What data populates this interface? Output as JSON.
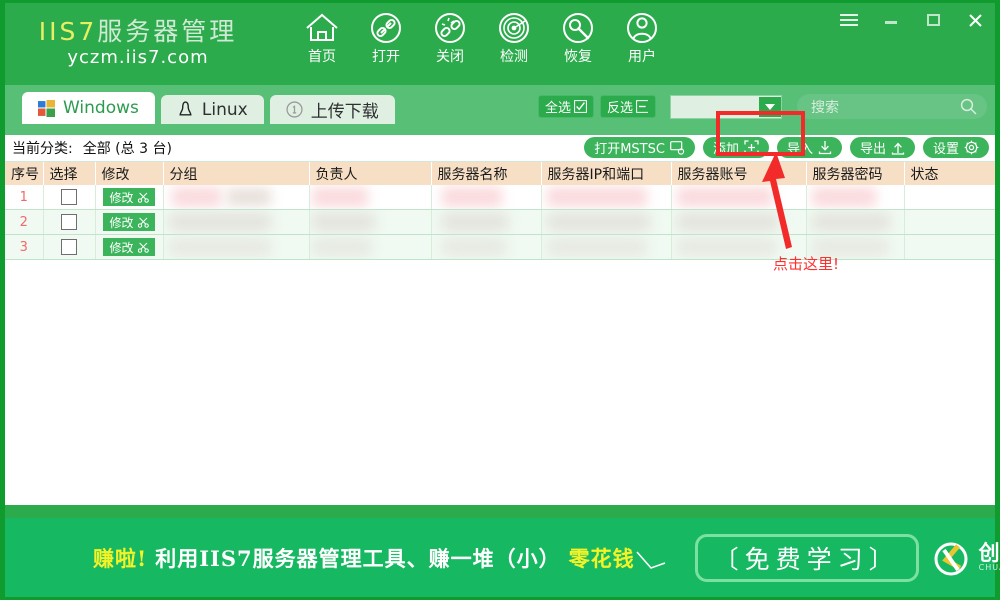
{
  "window": {
    "brand_title_prefix": "IIS7",
    "brand_title_rest": "服务器管理",
    "brand_sub": "yczm.iis7.com",
    "controls": {
      "menu": "menu-icon",
      "minimize": "minimize-icon",
      "maximize": "maximize-icon",
      "close": "close-icon"
    },
    "accent_green": "#2cab4c",
    "panel_green": "#58bf77",
    "header_orange": "#f6dfc4",
    "annotation_red": "#f22a2a"
  },
  "nav": {
    "items": [
      {
        "label": "首页",
        "icon": "home-icon"
      },
      {
        "label": "打开",
        "icon": "link-open-icon"
      },
      {
        "label": "关闭",
        "icon": "link-break-icon"
      },
      {
        "label": "检测",
        "icon": "radar-detect-icon"
      },
      {
        "label": "恢复",
        "icon": "wrench-restore-icon"
      },
      {
        "label": "用户",
        "icon": "user-icon"
      }
    ]
  },
  "tabs": [
    {
      "label": "Windows",
      "icon": "windows-logo-icon",
      "active": true
    },
    {
      "label": "Linux",
      "icon": "tux-penguin-icon",
      "active": false
    },
    {
      "label": "上传下载",
      "icon": "circle-one-icon",
      "active": false
    }
  ],
  "toolbar": {
    "select_all_label": "全选",
    "invert_select_label": "反选",
    "group_select_value": "",
    "search_placeholder": "搜索"
  },
  "subbar": {
    "category_label": "当前分类:",
    "category_value": "全部 (总 3 台)",
    "actions": [
      {
        "label": "打开MSTSC",
        "icon": "monitor-icon"
      },
      {
        "label": "添加",
        "icon": "plus-square-icon"
      },
      {
        "label": "导入",
        "icon": "download-arrow-icon"
      },
      {
        "label": "导出",
        "icon": "upload-arrow-icon"
      },
      {
        "label": "设置",
        "icon": "gear-icon"
      }
    ]
  },
  "table": {
    "columns": [
      "序号",
      "选择",
      "修改",
      "分组",
      "负责人",
      "服务器名称",
      "服务器IP和端口",
      "服务器账号",
      "服务器密码",
      "状态"
    ],
    "edit_label": "修改",
    "rows": [
      {
        "index": "1",
        "checked": false
      },
      {
        "index": "2",
        "checked": false
      },
      {
        "index": "3",
        "checked": false
      }
    ]
  },
  "annotation": {
    "callout_text": "点击这里!"
  },
  "banner": {
    "text_lead": "赚啦!",
    "text_mid": "利用IIS7服务器管理工具、赚一堆（小）",
    "text_tail": "零花钱",
    "free_learn_label": "〔免费学习〕",
    "logo_name": "创新互联",
    "logo_pinyin": "CHUANG XIN HU LIAN",
    "logo_icon": "cx-logo-icon"
  }
}
